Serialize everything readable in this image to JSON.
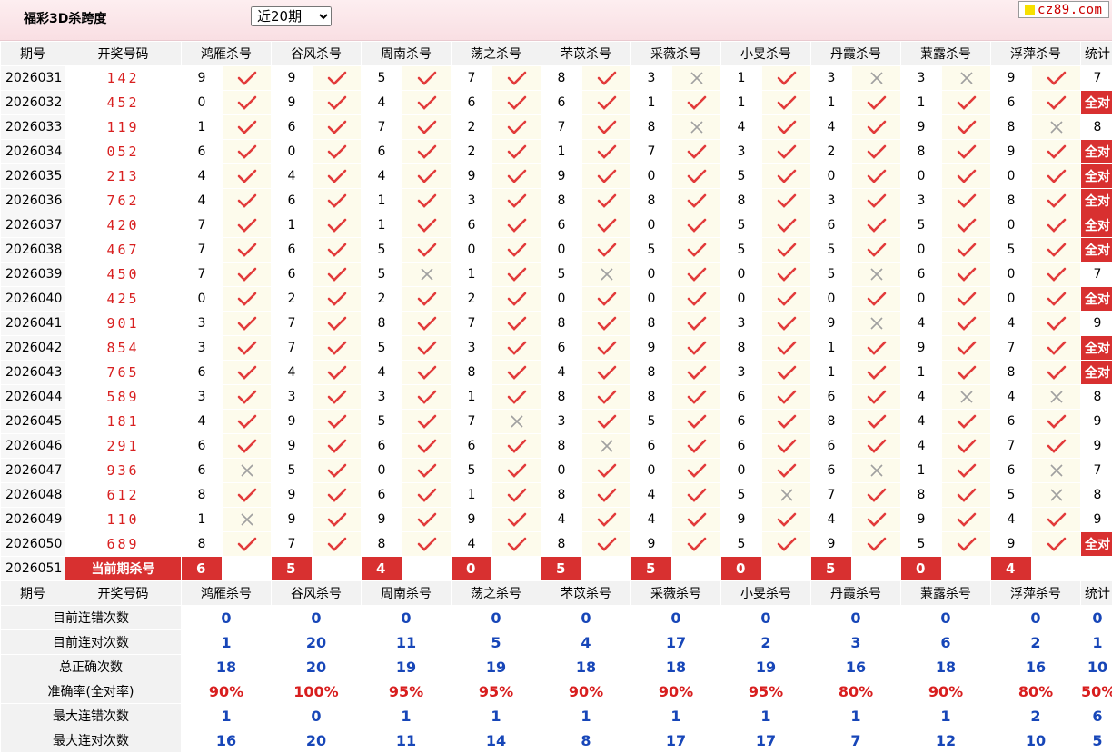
{
  "header": {
    "title": "福彩3D杀跨度",
    "select_value": "近20期",
    "logo_text": "cz89.com"
  },
  "columns": [
    "期号",
    "开奖号码",
    "鸿雁杀号",
    "谷风杀号",
    "周南杀号",
    "荡之杀号",
    "芣苡杀号",
    "采薇杀号",
    "小旻杀号",
    "丹霞杀号",
    "蒹露杀号",
    "浮萍杀号",
    "统计"
  ],
  "rows": [
    {
      "issue": "2026031",
      "draw": "142",
      "kills": [
        "9",
        "9",
        "5",
        "7",
        "8",
        "3",
        "1",
        "3",
        "3",
        "9"
      ],
      "hits": [
        1,
        1,
        1,
        1,
        1,
        0,
        1,
        0,
        0,
        1
      ],
      "stat": "7"
    },
    {
      "issue": "2026032",
      "draw": "452",
      "kills": [
        "0",
        "9",
        "4",
        "6",
        "6",
        "1",
        "1",
        "1",
        "1",
        "6"
      ],
      "hits": [
        1,
        1,
        1,
        1,
        1,
        1,
        1,
        1,
        1,
        1
      ],
      "stat": "全对"
    },
    {
      "issue": "2026033",
      "draw": "119",
      "kills": [
        "1",
        "6",
        "7",
        "2",
        "7",
        "8",
        "4",
        "4",
        "9",
        "8"
      ],
      "hits": [
        1,
        1,
        1,
        1,
        1,
        0,
        1,
        1,
        1,
        0
      ],
      "stat": "8"
    },
    {
      "issue": "2026034",
      "draw": "052",
      "kills": [
        "6",
        "0",
        "6",
        "2",
        "1",
        "7",
        "3",
        "2",
        "8",
        "9"
      ],
      "hits": [
        1,
        1,
        1,
        1,
        1,
        1,
        1,
        1,
        1,
        1
      ],
      "stat": "全对"
    },
    {
      "issue": "2026035",
      "draw": "213",
      "kills": [
        "4",
        "4",
        "4",
        "9",
        "9",
        "0",
        "5",
        "0",
        "0",
        "0"
      ],
      "hits": [
        1,
        1,
        1,
        1,
        1,
        1,
        1,
        1,
        1,
        1
      ],
      "stat": "全对"
    },
    {
      "issue": "2026036",
      "draw": "762",
      "kills": [
        "4",
        "6",
        "1",
        "3",
        "8",
        "8",
        "8",
        "3",
        "3",
        "8"
      ],
      "hits": [
        1,
        1,
        1,
        1,
        1,
        1,
        1,
        1,
        1,
        1
      ],
      "stat": "全对"
    },
    {
      "issue": "2026037",
      "draw": "420",
      "kills": [
        "7",
        "1",
        "1",
        "6",
        "6",
        "0",
        "5",
        "6",
        "5",
        "0"
      ],
      "hits": [
        1,
        1,
        1,
        1,
        1,
        1,
        1,
        1,
        1,
        1
      ],
      "stat": "全对"
    },
    {
      "issue": "2026038",
      "draw": "467",
      "kills": [
        "7",
        "6",
        "5",
        "0",
        "0",
        "5",
        "5",
        "5",
        "0",
        "5"
      ],
      "hits": [
        1,
        1,
        1,
        1,
        1,
        1,
        1,
        1,
        1,
        1
      ],
      "stat": "全对"
    },
    {
      "issue": "2026039",
      "draw": "450",
      "kills": [
        "7",
        "6",
        "5",
        "1",
        "5",
        "0",
        "0",
        "5",
        "6",
        "0"
      ],
      "hits": [
        1,
        1,
        0,
        1,
        0,
        1,
        1,
        0,
        1,
        1
      ],
      "stat": "7"
    },
    {
      "issue": "2026040",
      "draw": "425",
      "kills": [
        "0",
        "2",
        "2",
        "2",
        "0",
        "0",
        "0",
        "0",
        "0",
        "0"
      ],
      "hits": [
        1,
        1,
        1,
        1,
        1,
        1,
        1,
        1,
        1,
        1
      ],
      "stat": "全对"
    },
    {
      "issue": "2026041",
      "draw": "901",
      "kills": [
        "3",
        "7",
        "8",
        "7",
        "8",
        "8",
        "3",
        "9",
        "4",
        "4"
      ],
      "hits": [
        1,
        1,
        1,
        1,
        1,
        1,
        1,
        0,
        1,
        1
      ],
      "stat": "9"
    },
    {
      "issue": "2026042",
      "draw": "854",
      "kills": [
        "3",
        "7",
        "5",
        "3",
        "6",
        "9",
        "8",
        "1",
        "9",
        "7"
      ],
      "hits": [
        1,
        1,
        1,
        1,
        1,
        1,
        1,
        1,
        1,
        1
      ],
      "stat": "全对"
    },
    {
      "issue": "2026043",
      "draw": "765",
      "kills": [
        "6",
        "4",
        "4",
        "8",
        "4",
        "8",
        "3",
        "1",
        "1",
        "8"
      ],
      "hits": [
        1,
        1,
        1,
        1,
        1,
        1,
        1,
        1,
        1,
        1
      ],
      "stat": "全对"
    },
    {
      "issue": "2026044",
      "draw": "589",
      "kills": [
        "3",
        "3",
        "3",
        "1",
        "8",
        "8",
        "6",
        "6",
        "4",
        "4"
      ],
      "hits": [
        1,
        1,
        1,
        1,
        1,
        1,
        1,
        1,
        0,
        0
      ],
      "stat": "8"
    },
    {
      "issue": "2026045",
      "draw": "181",
      "kills": [
        "4",
        "9",
        "5",
        "7",
        "3",
        "5",
        "6",
        "8",
        "4",
        "6"
      ],
      "hits": [
        1,
        1,
        1,
        0,
        1,
        1,
        1,
        1,
        1,
        1
      ],
      "stat": "9"
    },
    {
      "issue": "2026046",
      "draw": "291",
      "kills": [
        "6",
        "9",
        "6",
        "6",
        "8",
        "6",
        "6",
        "6",
        "4",
        "7"
      ],
      "hits": [
        1,
        1,
        1,
        1,
        0,
        1,
        1,
        1,
        1,
        1
      ],
      "stat": "9"
    },
    {
      "issue": "2026047",
      "draw": "936",
      "kills": [
        "6",
        "5",
        "0",
        "5",
        "0",
        "0",
        "0",
        "6",
        "1",
        "6"
      ],
      "hits": [
        0,
        1,
        1,
        1,
        1,
        1,
        1,
        0,
        1,
        0
      ],
      "stat": "7"
    },
    {
      "issue": "2026048",
      "draw": "612",
      "kills": [
        "8",
        "9",
        "6",
        "1",
        "8",
        "4",
        "5",
        "7",
        "8",
        "5"
      ],
      "hits": [
        1,
        1,
        1,
        1,
        1,
        1,
        0,
        1,
        1,
        0
      ],
      "stat": "8"
    },
    {
      "issue": "2026049",
      "draw": "110",
      "kills": [
        "1",
        "9",
        "9",
        "9",
        "4",
        "4",
        "9",
        "4",
        "9",
        "4"
      ],
      "hits": [
        0,
        1,
        1,
        1,
        1,
        1,
        1,
        1,
        1,
        1
      ],
      "stat": "9"
    },
    {
      "issue": "2026050",
      "draw": "689",
      "kills": [
        "8",
        "7",
        "8",
        "4",
        "8",
        "9",
        "5",
        "9",
        "5",
        "9"
      ],
      "hits": [
        1,
        1,
        1,
        1,
        1,
        1,
        1,
        1,
        1,
        1
      ],
      "stat": "全对"
    }
  ],
  "current": {
    "issue": "2026051",
    "label": "当前期杀号",
    "kills": [
      "6",
      "5",
      "4",
      "0",
      "5",
      "5",
      "0",
      "5",
      "0",
      "4"
    ]
  },
  "summary": {
    "rows": [
      {
        "label": "目前连错次数",
        "values": [
          "0",
          "0",
          "0",
          "0",
          "0",
          "0",
          "0",
          "0",
          "0",
          "0",
          "0"
        ],
        "style": "num"
      },
      {
        "label": "目前连对次数",
        "values": [
          "1",
          "20",
          "11",
          "5",
          "4",
          "17",
          "2",
          "3",
          "6",
          "2",
          "1"
        ],
        "style": "num"
      },
      {
        "label": "总正确次数",
        "values": [
          "18",
          "20",
          "19",
          "19",
          "18",
          "18",
          "19",
          "16",
          "18",
          "16",
          "10"
        ],
        "style": "num"
      },
      {
        "label": "准确率(全对率)",
        "values": [
          "90%",
          "100%",
          "95%",
          "95%",
          "90%",
          "90%",
          "95%",
          "80%",
          "90%",
          "80%",
          "50%"
        ],
        "style": "pct"
      },
      {
        "label": "最大连错次数",
        "values": [
          "1",
          "0",
          "1",
          "1",
          "1",
          "1",
          "1",
          "1",
          "1",
          "2",
          "6"
        ],
        "style": "num"
      },
      {
        "label": "最大连对次数",
        "values": [
          "16",
          "20",
          "11",
          "14",
          "8",
          "17",
          "17",
          "7",
          "12",
          "10",
          "5"
        ],
        "style": "num"
      }
    ]
  },
  "colors": {
    "check": "#e23a3a",
    "cross": "#a0a0a0",
    "highlight": "#d83030",
    "blue": "#1746b8"
  },
  "icons": {
    "hit": "check-icon",
    "miss": "cross-icon"
  }
}
